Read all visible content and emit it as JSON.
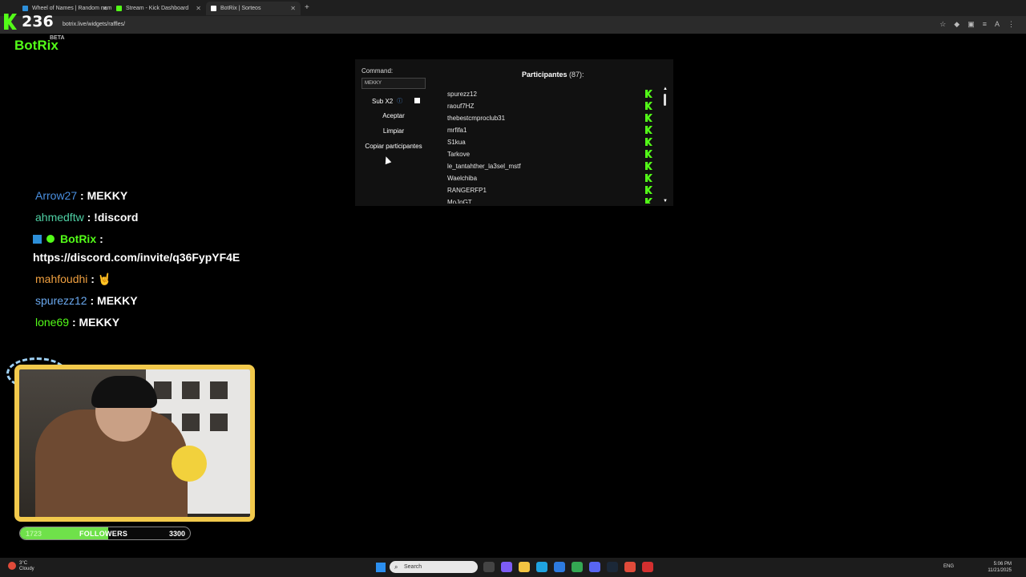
{
  "browser": {
    "tabs": [
      {
        "label": "Wheel of Names | Random nam",
        "favicon_color": "#2d8fd9"
      },
      {
        "label": "Stream - Kick Dashboard",
        "favicon_color": "#53fc18"
      },
      {
        "label": "BotRix | Sorteos",
        "favicon_color": "#ffffff"
      }
    ],
    "url": "botrix.live/widgets/raffles/"
  },
  "viewer_count": "236",
  "app": {
    "logo": "BotRix",
    "badge": "BETA"
  },
  "raffle": {
    "command_label": "Command:",
    "command_value": "MEKKY",
    "sub_label": "Sub X2",
    "sub_checked": false,
    "accept_label": "Aceptar",
    "clear_label": "Limpiar",
    "copy_label": "Copiar participantes",
    "participants_title": "Participantes",
    "participants_count": "(87):",
    "participants": [
      "spurezz12",
      "raouf7HZ",
      "thebestcmproclub31",
      "mrfifa1",
      "S1kua",
      "Tarkove",
      "le_tantahther_la3sel_mstf",
      "Waelchiba",
      "RANGERFP1",
      "MoJoGT"
    ]
  },
  "chat": {
    "messages": [
      {
        "user": "Arrow27",
        "color": "#4a8fe0",
        "text": "MEKKY"
      },
      {
        "user": "ahmedftw",
        "color": "#4fd1a5",
        "text": "!discord"
      },
      {
        "user": "BotRix",
        "color": "#53fc18",
        "text": ""
      },
      {
        "user": "",
        "color": "#ffffff",
        "text": "https://discord.com/invite/q36FypYF4E"
      },
      {
        "user": "mahfoudhi",
        "color": "#f0a040",
        "text": "🤘"
      },
      {
        "user": "spurezz12",
        "color": "#6aa8ee",
        "text": "MEKKY"
      },
      {
        "user": "lone69",
        "color": "#53fc18",
        "text": "MEKKY"
      }
    ],
    "separator": ":"
  },
  "followers": {
    "current": "1723",
    "label": "FOLLOWERS",
    "goal": "3300",
    "progress": 0.52
  },
  "taskbar": {
    "weather_temp": "3°C",
    "weather_text": "Cloudy",
    "search_placeholder": "Search",
    "tray_lang": "ENG",
    "time": "5:06 PM",
    "date": "11/21/2025"
  }
}
